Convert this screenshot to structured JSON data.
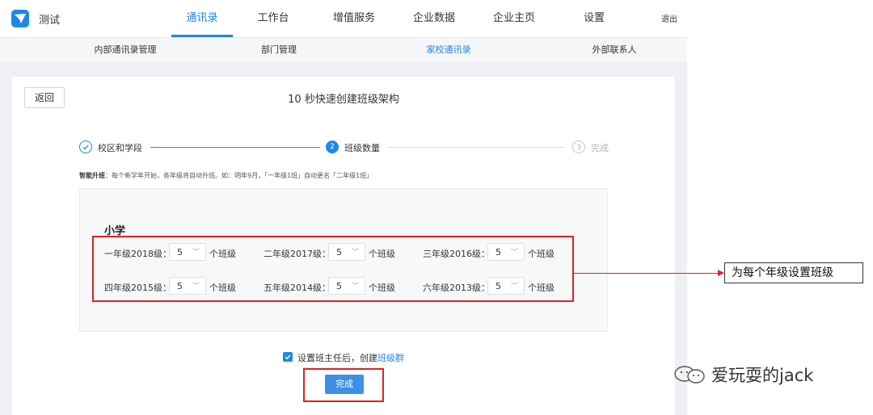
{
  "app": {
    "name": "测试"
  },
  "nav": [
    {
      "label": "通讯录",
      "active": true
    },
    {
      "label": "工作台"
    },
    {
      "label": "增值服务"
    },
    {
      "label": "企业数据"
    },
    {
      "label": "企业主页"
    },
    {
      "label": "设置"
    }
  ],
  "logout_label": "退出",
  "subnav": [
    {
      "label": "内部通讯录管理"
    },
    {
      "label": "部门管理"
    },
    {
      "label": "家校通讯录",
      "active": true
    },
    {
      "label": "外部联系人"
    }
  ],
  "back_label": "返回",
  "page_title": "10 秒快速创建班级架构",
  "steps": [
    {
      "label": "校区和学段",
      "state": "done"
    },
    {
      "number": "2",
      "label": "班级数量",
      "state": "active"
    },
    {
      "number": "3",
      "label": "完成",
      "state": "pending"
    }
  ],
  "hint": {
    "bold": "智能升班",
    "text": "：每个新学年开始，各年级将自动升班。如：明年9月，「一年级1班」自动更名「二年级1班」"
  },
  "section_title": "小学",
  "grades": [
    {
      "label": "一年级2018级：",
      "value": "5",
      "unit": "个班级"
    },
    {
      "label": "二年级2017级：",
      "value": "5",
      "unit": "个班级"
    },
    {
      "label": "三年级2016级：",
      "value": "5",
      "unit": "个班级"
    },
    {
      "label": "四年级2015级：",
      "value": "5",
      "unit": "个班级"
    },
    {
      "label": "五年级2014级：",
      "value": "5",
      "unit": "个班级"
    },
    {
      "label": "六年级2013级：",
      "value": "5",
      "unit": "个班级"
    }
  ],
  "checkbox": {
    "label": "设置班主任后，创建",
    "link": "班级群",
    "checked": true
  },
  "done_label": "完成",
  "annotation": "为每个年级设置班级",
  "watermark": "爱玩耍的jack",
  "colors": {
    "accent": "#1e88e5",
    "highlight": "#e02020"
  }
}
